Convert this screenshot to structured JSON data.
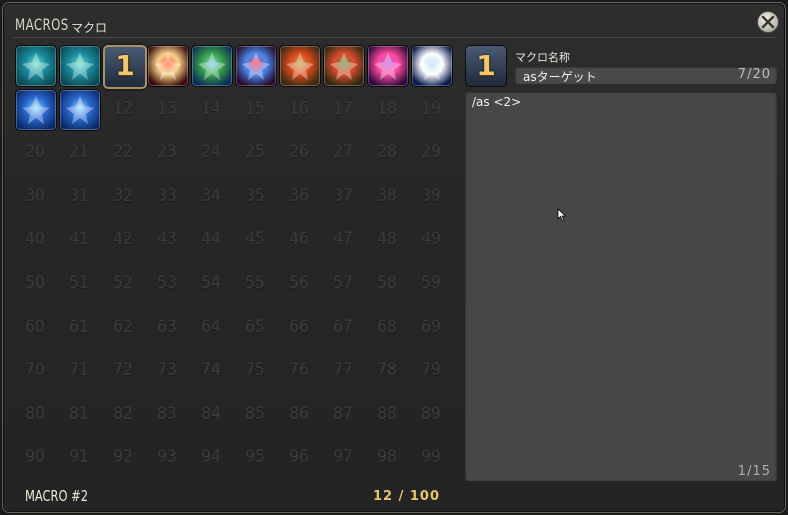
{
  "window": {
    "title": "MACROS",
    "subtitle": "マクロ"
  },
  "slots": {
    "icons": [
      {
        "icon": "figure-green-icon",
        "colors": [
          "#0c4a54",
          "#6de0c8",
          "#1a8fa0"
        ]
      },
      {
        "icon": "figure-green-icon",
        "colors": [
          "#0c4a54",
          "#6de0c8",
          "#1a8fa0"
        ]
      },
      {
        "icon": "number-1-icon",
        "label": "1"
      },
      {
        "icon": "slash-red-icon",
        "colors": [
          "#3a0a06",
          "#ff5a2a",
          "#f6d08a"
        ]
      },
      {
        "icon": "wave-blue-icon",
        "colors": [
          "#0b2f5a",
          "#7fd0f0",
          "#3aa24a"
        ]
      },
      {
        "icon": "strike-red-icon",
        "colors": [
          "#2a0a2a",
          "#ff3050",
          "#4a8af0"
        ]
      },
      {
        "icon": "axe-icon",
        "colors": [
          "#3a2a14",
          "#c8a04a",
          "#d84a1a"
        ]
      },
      {
        "icon": "shield-icon",
        "colors": [
          "#2a2a14",
          "#6a8a3a",
          "#d84a2a"
        ]
      },
      {
        "icon": "swirl-purple-icon",
        "colors": [
          "#2a0a3a",
          "#c05ae0",
          "#ff4aa0"
        ]
      },
      {
        "icon": "sword-light-icon",
        "colors": [
          "#0a1a4a",
          "#b0d8ff",
          "#ffffff"
        ]
      },
      {
        "icon": "leap-blue-icon",
        "colors": [
          "#0a2a6a",
          "#9ee0ff",
          "#2a6ad0"
        ]
      },
      {
        "icon": "leap-blue-icon",
        "colors": [
          "#0a2a6a",
          "#9ee0ff",
          "#2a6ad0"
        ]
      }
    ],
    "empty_numbers": [
      "12",
      "13",
      "14",
      "15",
      "16",
      "17",
      "18",
      "19",
      "20",
      "21",
      "22",
      "23",
      "24",
      "25",
      "26",
      "27",
      "28",
      "29",
      "30",
      "31",
      "32",
      "33",
      "34",
      "35",
      "36",
      "37",
      "38",
      "39",
      "40",
      "41",
      "42",
      "43",
      "44",
      "45",
      "46",
      "47",
      "48",
      "49",
      "50",
      "51",
      "52",
      "53",
      "54",
      "55",
      "56",
      "57",
      "58",
      "59",
      "60",
      "61",
      "62",
      "63",
      "64",
      "65",
      "66",
      "67",
      "68",
      "69",
      "70",
      "71",
      "72",
      "73",
      "74",
      "75",
      "76",
      "77",
      "78",
      "79",
      "80",
      "81",
      "82",
      "83",
      "84",
      "85",
      "86",
      "87",
      "88",
      "89",
      "90",
      "91",
      "92",
      "93",
      "94",
      "95",
      "96",
      "97",
      "98",
      "99"
    ]
  },
  "detail": {
    "icon_label": "1",
    "name_label": "マクロ名称",
    "name_value": "asターゲット",
    "name_count": "7/20",
    "macro_text": "/as <2>",
    "line_count": "1/15"
  },
  "footer": {
    "macro_label": "MACRO #2",
    "count": "12 / 100"
  }
}
